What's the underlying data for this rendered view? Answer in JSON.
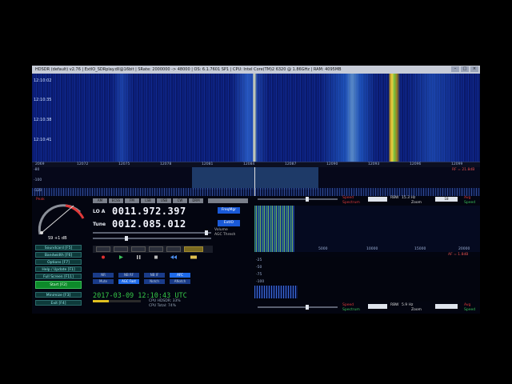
{
  "title_bar": {
    "text": "HDSDR (default) v2.76 | ExtIO_SDRplay.dll@16bit | SRate: 2000000 -> 48000 | OS: 6.1.7601 SP1 | CPU: Intel Core(TM)2 6320 @ 1.86GHz | RAM: 4095MB",
    "min": "–",
    "max": "□",
    "close": "×"
  },
  "waterfall": {
    "time_labels": [
      "12:10:02",
      "12:10:35",
      "12:10:38",
      "12:10:41"
    ]
  },
  "freq_axis": {
    "ticks": [
      "2069",
      "12072",
      "12075",
      "12078",
      "12081",
      "12084",
      "12087",
      "12090",
      "12093",
      "12096",
      "12099"
    ]
  },
  "spectrum": {
    "db_labels": [
      "-80",
      "-100",
      "-120"
    ],
    "rf_gain": "RF = 21.8dB"
  },
  "smeter": {
    "reading": "S9 +1 dB",
    "peak_label": "Peak"
  },
  "function_buttons": [
    {
      "label": "Soundcard [F5]"
    },
    {
      "label": "Bandwidth [F6]"
    },
    {
      "label": "Options [F7]"
    },
    {
      "label": "Help / Update [F1]"
    },
    {
      "label": "Full Screen [F11]"
    },
    {
      "label": "Start [F2]"
    },
    {
      "label": "Minimize [F3]"
    },
    {
      "label": "Exit [F4]"
    }
  ],
  "mode_tabs": [
    "AM",
    "ECSS",
    "FM",
    "LSB",
    "USB",
    "CW",
    "DRM"
  ],
  "lo": {
    "label": "LO A",
    "value": "0011.972.397",
    "button": "FreqMgr"
  },
  "tune": {
    "label": "Tune",
    "value": "0012.085.012",
    "button": "ExtIO"
  },
  "volume_label": "Volume",
  "agc_label": "AGC Thresh",
  "dsp_buttons": [
    {
      "label": "NR",
      "active": false
    },
    {
      "label": "NB RF",
      "active": false
    },
    {
      "label": "NB IF",
      "active": false
    },
    {
      "label": "AFC",
      "active": true
    },
    {
      "label": "Mute",
      "active": false
    },
    {
      "label": "AGC Fast",
      "active": true
    },
    {
      "label": "Notch",
      "active": false
    },
    {
      "label": "ANotch",
      "active": false
    }
  ],
  "status": {
    "datetime": "2017-03-09  12:10:43 UTC",
    "cpu_hdsdr": "CPU HDSDR: 33%",
    "cpu_total": "CPU Total: 74%"
  },
  "zoom_panel_top": {
    "speed_label": "Speed",
    "rbw_label": "RBW",
    "rbw_value": "15.3 Hz",
    "zoom_label": "Zoom",
    "avg_label": "Avg",
    "spectrum_label": "Spectrum",
    "speed_value": "18",
    "ticks": [
      "5000",
      "10000",
      "15000",
      "20000"
    ],
    "af_gain": "AF = 1.8dB"
  },
  "zoom_panel_bottom": {
    "db_labels": [
      "-25",
      "-50",
      "-75",
      "-100",
      "-125",
      "-150"
    ],
    "rbw_label": "RBW",
    "rbw_value": "5.9 Hz",
    "zoom_label": "Zoom",
    "avg_label": "Avg",
    "speed_label": "Speed",
    "spectrum_label": "Spectrum"
  },
  "colors": {
    "accent_blue": "#1e6ae8",
    "green_text": "#36c848",
    "red_label": "#e03a3a"
  }
}
